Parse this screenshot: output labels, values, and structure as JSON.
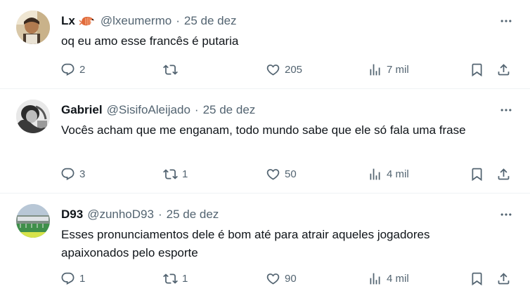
{
  "tweets": [
    {
      "name": "Lx",
      "name_emoji": "shrimp-emoji",
      "handle": "@lxeumermo",
      "date": "25 de dez",
      "text": "oq eu amo esse francês é putaria",
      "replies": "2",
      "retweets": "",
      "likes": "205",
      "views": "7 mil"
    },
    {
      "name": "Gabriel",
      "handle": "@SisifoAleijado",
      "date": "25 de dez",
      "text": "Vocês acham que me enganam, todo mundo sabe que ele só fala uma frase",
      "replies": "3",
      "retweets": "1",
      "likes": "50",
      "views": "4 mil"
    },
    {
      "name": "D93",
      "handle": "@zunhoD93",
      "date": "25 de dez",
      "text": "Esses pronunciamentos dele é bom até para atrair aqueles jogadores apaixonados pelo esporte",
      "replies": "1",
      "retweets": "1",
      "likes": "90",
      "views": "4 mil"
    }
  ],
  "separator": "·",
  "icons": [
    "more-icon",
    "reply-icon",
    "retweet-icon",
    "like-icon",
    "views-icon",
    "bookmark-icon",
    "share-icon"
  ],
  "colors": {
    "text": "#0f1419",
    "secondary": "#536471",
    "divider": "#eff3f4"
  }
}
